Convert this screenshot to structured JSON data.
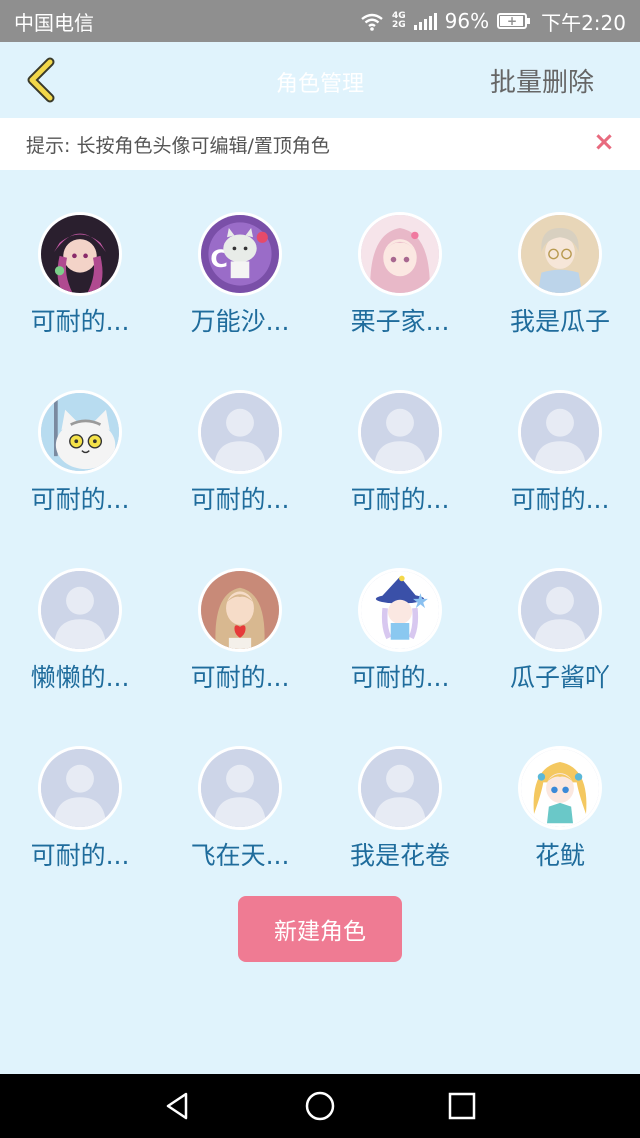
{
  "status_bar": {
    "carrier": "中国电信",
    "network_tag_top": "4G",
    "network_tag_bottom": "2G",
    "battery_percent": "96%",
    "battery_level": 0.96,
    "time": "下午2:20"
  },
  "header": {
    "back_icon": "chevron-left-icon",
    "title": "角色管理",
    "batch_delete": "批量删除"
  },
  "tip": {
    "text": "提示: 长按角色头像可编辑/置顶角色",
    "close_icon": "close-icon"
  },
  "roles": [
    {
      "name": "可耐的...",
      "avatar": "anime-girl-dark"
    },
    {
      "name": "万能沙...",
      "avatar": "cat-logo"
    },
    {
      "name": "栗子家...",
      "avatar": "anime-girl-pink"
    },
    {
      "name": "我是瓜子",
      "avatar": "anime-boy-glasses"
    },
    {
      "name": "可耐的...",
      "avatar": "cartoon-cat"
    },
    {
      "name": "可耐的...",
      "avatar": "default-person"
    },
    {
      "name": "可耐的...",
      "avatar": "default-person"
    },
    {
      "name": "可耐的...",
      "avatar": "default-person"
    },
    {
      "name": "懒懒的...",
      "avatar": "default-person"
    },
    {
      "name": "可耐的...",
      "avatar": "anime-girl-heart"
    },
    {
      "name": "可耐的...",
      "avatar": "anime-witch"
    },
    {
      "name": "瓜子酱吖",
      "avatar": "default-person"
    },
    {
      "name": "可耐的...",
      "avatar": "default-person"
    },
    {
      "name": "飞在天...",
      "avatar": "default-person"
    },
    {
      "name": "我是花卷",
      "avatar": "default-person"
    },
    {
      "name": "花鱿",
      "avatar": "anime-girl-blonde"
    }
  ],
  "new_role_button": "新建角色",
  "nav": {
    "back_icon": "triangle-back-icon",
    "home_icon": "circle-home-icon",
    "recents_icon": "square-recents-icon"
  },
  "colors": {
    "background": "#e0f3fc",
    "accent_button": "#ef7b93",
    "name_text": "#1f6c9c",
    "back_chevron": "#f2d84a",
    "close_x": "#e86a7e"
  }
}
